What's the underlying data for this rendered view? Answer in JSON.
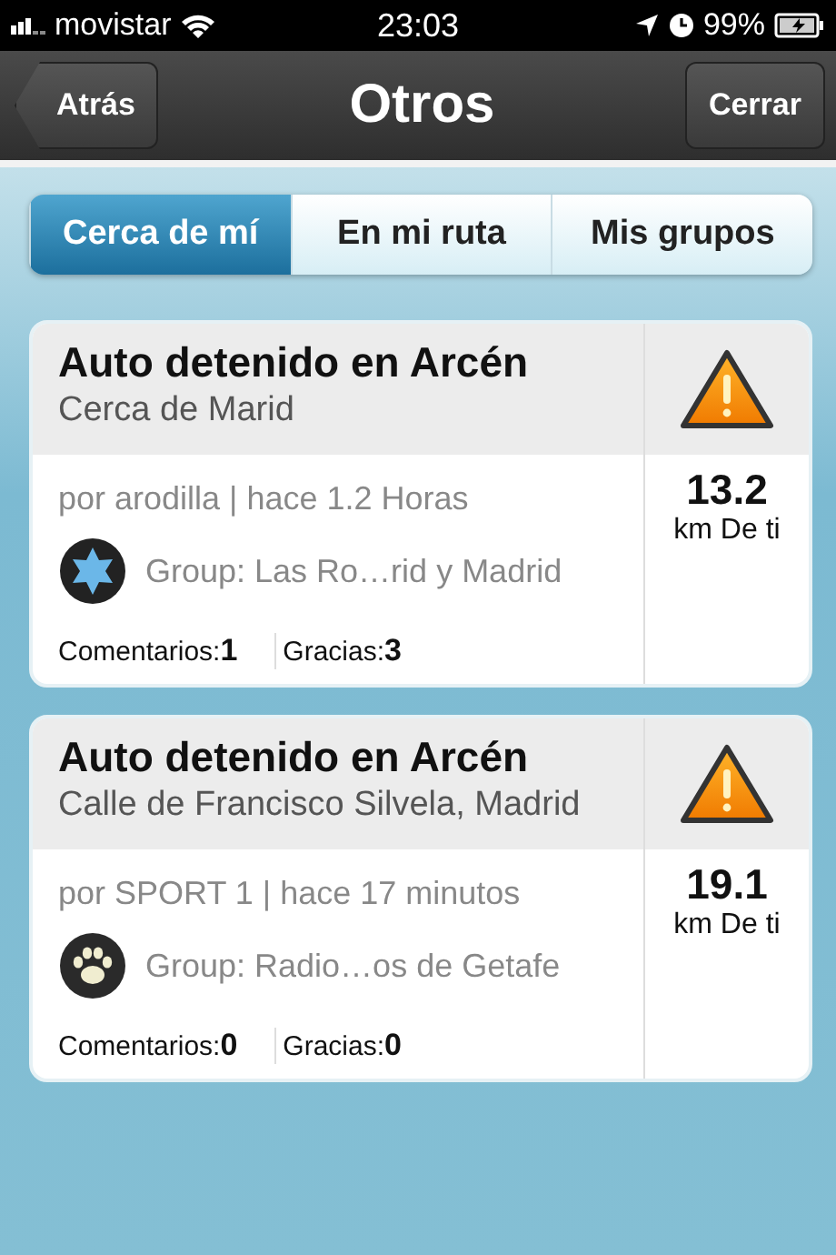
{
  "status_bar": {
    "carrier": "movistar",
    "time": "23:03",
    "battery": "99%"
  },
  "nav": {
    "back": "Atrás",
    "title": "Otros",
    "close": "Cerrar"
  },
  "tabs": [
    {
      "label": "Cerca de mí",
      "selected": true
    },
    {
      "label": "En mi ruta",
      "selected": false
    },
    {
      "label": "Mis grupos",
      "selected": false
    }
  ],
  "reports": [
    {
      "title": "Auto detenido en Arcén",
      "location": "Cerca de Marid",
      "meta": "por arodilla | hace 1.2 Horas",
      "kind": "star",
      "group": "Group: Las Ro…rid y Madrid",
      "comments_label": "Comentarios:",
      "comments": "1",
      "thanks_label": "Gracias:",
      "thanks": "3",
      "distance": "13.2",
      "distance_unit": "km De ti"
    },
    {
      "title": "Auto detenido en Arcén",
      "location": "Calle de Francisco Silvela, Madrid",
      "meta": "por SPORT 1 | hace 17 minutos",
      "kind": "paw",
      "group": "Group: Radio…os de Getafe",
      "comments_label": "Comentarios:",
      "comments": "0",
      "thanks_label": "Gracias:",
      "thanks": "0",
      "distance": "19.1",
      "distance_unit": "km De ti"
    }
  ]
}
